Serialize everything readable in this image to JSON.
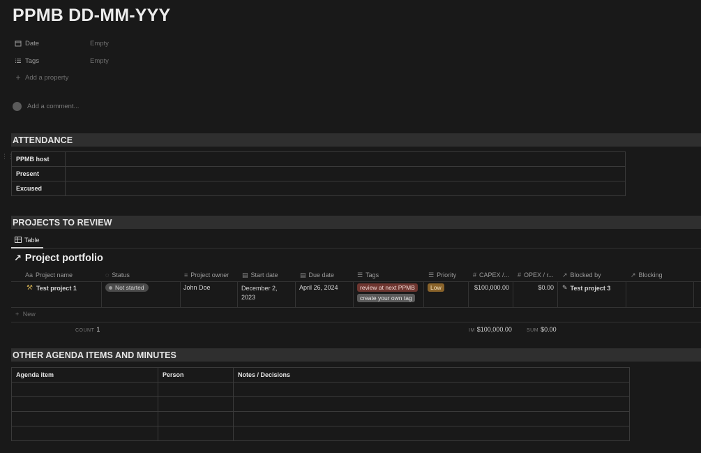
{
  "page": {
    "title": "PPMB DD-MM-YYY"
  },
  "properties": [
    {
      "icon": "calendar-icon",
      "label": "Date",
      "value": "Empty"
    },
    {
      "icon": "list-icon",
      "label": "Tags",
      "value": "Empty"
    }
  ],
  "add_property": "Add a property",
  "comment": {
    "placeholder": "Add a comment..."
  },
  "sections": {
    "attendance": "ATTENDANCE",
    "projects": "PROJECTS TO REVIEW",
    "agenda": "OTHER AGENDA ITEMS AND MINUTES"
  },
  "attendance_rows": [
    "PPMB host",
    "Present",
    "Excused"
  ],
  "view_tab": {
    "icon": "table-icon",
    "label": "Table"
  },
  "database": {
    "title": "Project portfolio",
    "columns": [
      {
        "icon": "text-icon",
        "glyph": "Aa",
        "label": "Project name"
      },
      {
        "icon": "status-icon",
        "glyph": "◌",
        "label": "Status"
      },
      {
        "icon": "person-icon",
        "glyph": "≡",
        "label": "Project owner"
      },
      {
        "icon": "calendar-icon",
        "glyph": "▤",
        "label": "Start date"
      },
      {
        "icon": "calendar-icon",
        "glyph": "▤",
        "label": "Due date"
      },
      {
        "icon": "list-icon",
        "glyph": "☰",
        "label": "Tags"
      },
      {
        "icon": "list-icon",
        "glyph": "☰",
        "label": "Priority"
      },
      {
        "icon": "number-icon",
        "glyph": "#",
        "label": "CAPEX /..."
      },
      {
        "icon": "number-icon",
        "glyph": "#",
        "label": "OPEX / r..."
      },
      {
        "icon": "relation-icon",
        "glyph": "↗",
        "label": "Blocked by"
      },
      {
        "icon": "relation-icon",
        "glyph": "↗",
        "label": "Blocking"
      }
    ],
    "row": {
      "name": "Test project 1",
      "status": "Not started",
      "owner": "John Doe",
      "start_date_line1": "December 2,",
      "start_date_line2": "2023",
      "due_date": "April 26, 2024",
      "tags": [
        "review at next PPMB",
        "create your own tag"
      ],
      "priority": "Low",
      "capex": "$100,000.00",
      "opex": "$0.00",
      "blocked_by": "Test project 3"
    },
    "new_label": "New",
    "footer": {
      "count_label": "COUNT",
      "count_value": "1",
      "capex_label": "IM",
      "capex_value": "$100,000.00",
      "opex_label": "SUM",
      "opex_value": "$0.00"
    }
  },
  "agenda_table": {
    "headers": [
      "Agenda item",
      "Person",
      "Notes / Decisions"
    ],
    "empty_rows": 4
  },
  "colors": {
    "background": "#191919",
    "section_bar": "#2f2f2f",
    "tag_red": "#6e3630",
    "priority_low": "#89632a"
  }
}
